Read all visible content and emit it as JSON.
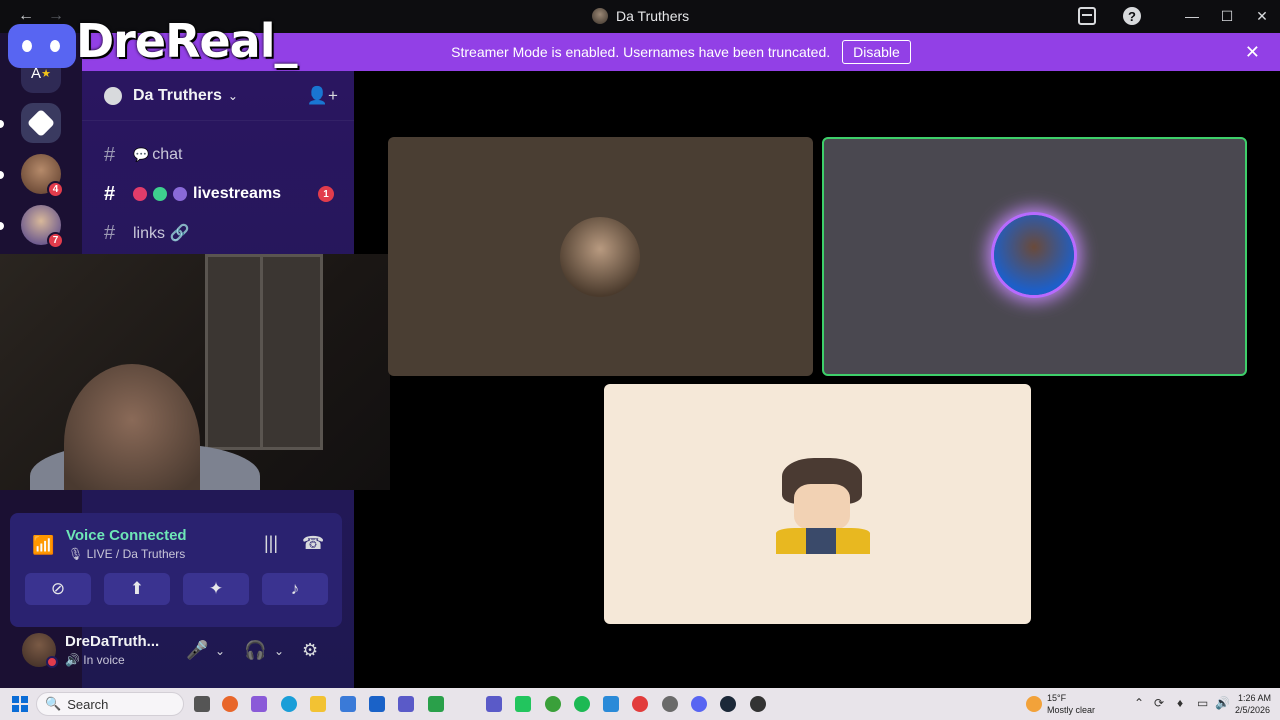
{
  "window": {
    "title": "Da Truthers",
    "back_arrow": "←",
    "forward_arrow": "→",
    "minimize": "—",
    "maximize": "☐",
    "close": "✕"
  },
  "overlay": {
    "streamer_name": "DreReal_"
  },
  "banner": {
    "message": "Streamer Mode is enabled. Usernames have been truncated.",
    "button_label": "Disable",
    "close_glyph": "✕",
    "color": "#9240e6"
  },
  "rail": {
    "items": [
      {
        "label": "A",
        "badge": ""
      },
      {
        "label": "",
        "badge": ""
      },
      {
        "label": "",
        "badge": "4"
      },
      {
        "label": "",
        "badge": "7"
      }
    ]
  },
  "server": {
    "name": "Da Truthers",
    "chevron": "⌄"
  },
  "channels": [
    {
      "hash": "#",
      "prefix": "💬",
      "name": "chat",
      "bold": false,
      "badge": ""
    },
    {
      "hash": "#",
      "prefix": "",
      "name": "livestreams",
      "bold": true,
      "badge": "1"
    },
    {
      "hash": "#",
      "prefix": "",
      "name": "links 🔗",
      "bold": false,
      "badge": ""
    }
  ],
  "voice": {
    "status": "Voice Connected",
    "location": "LIVE / Da Truthers",
    "accent": "#6ee7b7"
  },
  "user": {
    "name": "DreDaTruth...",
    "status": "In voice"
  },
  "taskbar": {
    "search_label": "Search",
    "weather_temp": "15°F",
    "weather_desc": "Mostly clear",
    "time": "1:26 AM",
    "date": "2/5/2026"
  }
}
